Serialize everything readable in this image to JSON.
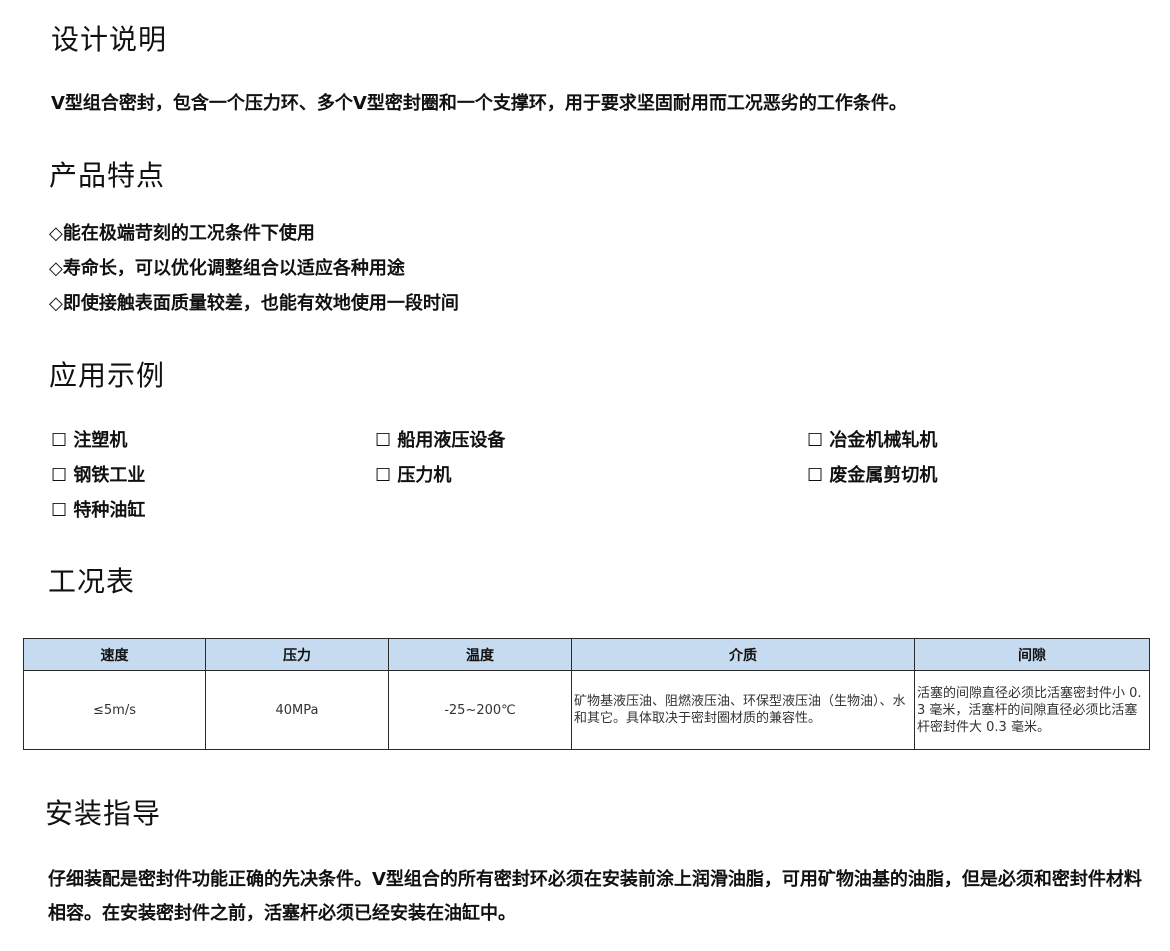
{
  "design": {
    "title": "设计说明",
    "text": "V型组合密封，包含一个压力环、多个V型密封圈和一个支撑环，用于要求坚固耐用而工况恶劣的工作条件。"
  },
  "features": {
    "title": "产品特点",
    "items": [
      "◇能在极端苛刻的工况条件下使用",
      "◇寿命长，可以优化调整组合以适应各种用途",
      "◇即使接触表面质量较差，也能有效地使用一段时间"
    ]
  },
  "applications": {
    "title": "应用示例",
    "items": [
      "☐ 注塑机",
      "☐ 船用液压设备",
      "☐ 冶金机械轧机",
      "☐ 钢铁工业",
      "☐ 压力机",
      "☐ 废金属剪切机",
      "☐ 特种油缸"
    ]
  },
  "conditions": {
    "title": "工况表",
    "headers": [
      "速度",
      "压力",
      "温度",
      "介质",
      "间隙"
    ],
    "row": [
      "≤5m/s",
      "40MPa",
      "-25~200℃",
      "矿物基液压油、阻燃液压油、环保型液压油（生物油）、水和其它。具体取决于密封圈材质的兼容性。",
      "活塞的间隙直径必须比活塞密封件小 0.3 毫米，活塞杆的间隙直径必须比活塞杆密封件大 0.3 毫米。"
    ]
  },
  "install": {
    "title": "安装指导",
    "text": "仔细装配是密封件功能正确的先决条件。V型组合的所有密封环必须在安装前涂上润滑油脂，可用矿物油基的油脂，但是必须和密封件材料相容。在安装密封件之前，活塞杆必须已经安装在油缸中。"
  },
  "colors": {
    "table_header_bg": "#c6dbef",
    "border": "#2a2a2a"
  }
}
